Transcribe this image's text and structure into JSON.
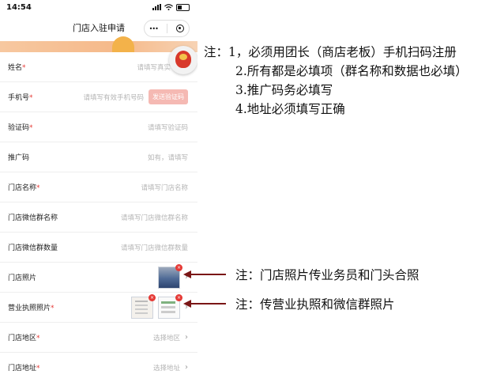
{
  "status_bar": {
    "time": "14:54"
  },
  "nav": {
    "title": "门店入驻申请",
    "more": "•••"
  },
  "form": {
    "rows": [
      {
        "label": "姓名",
        "required": "*",
        "placeholder": "请填写真实"
      },
      {
        "label": "手机号",
        "required": "*",
        "placeholder": "请填写有效手机号码",
        "button": "发送验证码"
      },
      {
        "label": "验证码",
        "required": "*",
        "placeholder": "请填写验证码"
      },
      {
        "label": "推广码",
        "required": "",
        "placeholder": "如有，请填写"
      },
      {
        "label": "门店名称",
        "required": "*",
        "placeholder": "请填写门店名称"
      },
      {
        "label": "门店微信群名称",
        "required": "",
        "placeholder": "请填写门店微信群名称"
      },
      {
        "label": "门店微信群数量",
        "required": "",
        "placeholder": "请填写门店微信群数量"
      },
      {
        "label": "门店照片",
        "required": ""
      },
      {
        "label": "营业执照照片",
        "required": "*"
      },
      {
        "label": "门店地区",
        "required": "*",
        "placeholder": "选择地区",
        "chevron": "›"
      },
      {
        "label": "门店地址",
        "required": "*",
        "placeholder": "选择地址",
        "chevron": "›"
      }
    ]
  },
  "annotations": {
    "main": {
      "prefix": "注：",
      "lines": [
        "1，必须用团长（商店老板）手机扫码注册",
        "2.所有都是必填项（群名称和数据也必填）",
        "3.推广码务必填写",
        "4.地址必须填写正确"
      ]
    },
    "photo_note": "注：门店照片传业务员和门头合照",
    "license_note": "注：传营业执照和微信群照片"
  },
  "colors": {
    "required": "#e53935",
    "arrow": "#7a1616",
    "sms_button": "#f5b9b3"
  }
}
